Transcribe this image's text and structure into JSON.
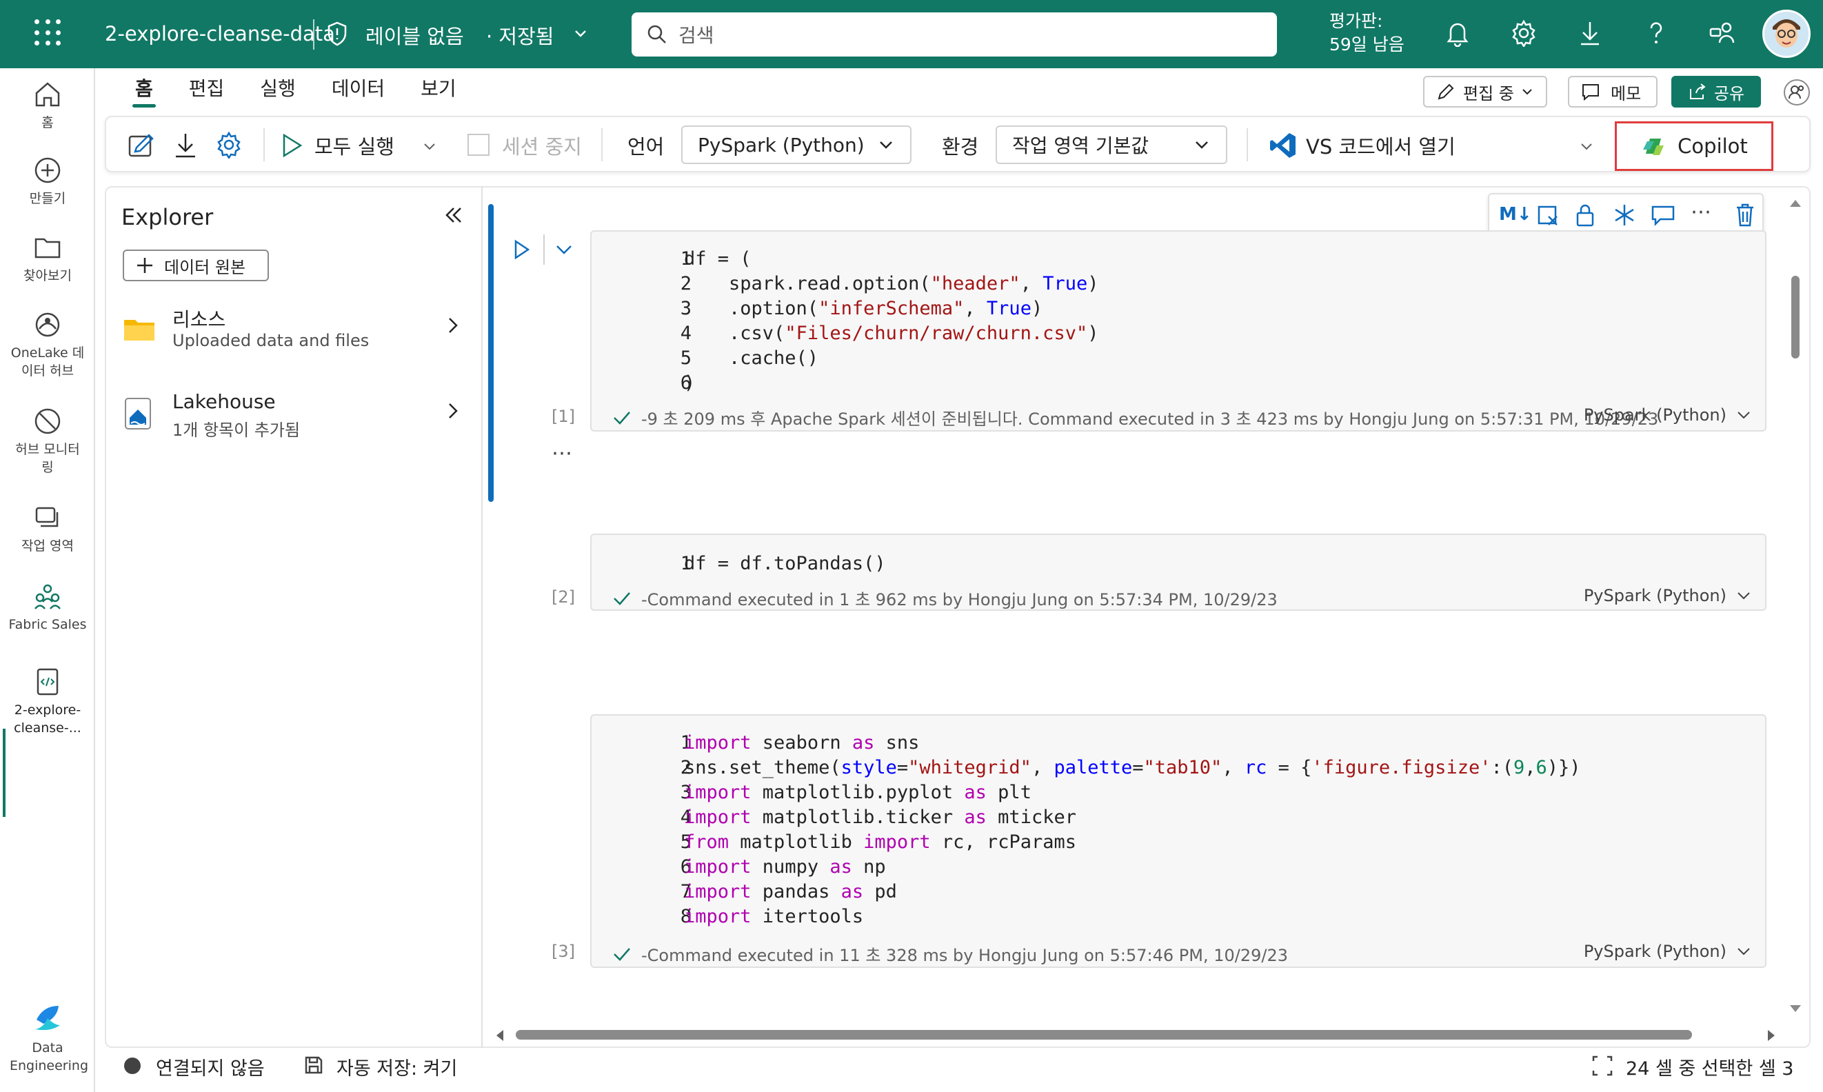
{
  "topbar": {
    "notebook_name": "2-explore-cleanse-data",
    "sensitivity_label": "레이블 없음",
    "save_status": "· 저장됨",
    "search_placeholder": "검색",
    "trial_line1": "평가판:",
    "trial_line2": "59일 남음"
  },
  "leftrail": {
    "items": [
      {
        "label": "홈",
        "icon": "home-icon"
      },
      {
        "label": "만들기",
        "icon": "create-icon"
      },
      {
        "label": "찾아보기",
        "icon": "folder-icon"
      },
      {
        "label": "OneLake 데이터 허브",
        "icon": "onelake-icon"
      },
      {
        "label": "허브 모니터링",
        "icon": "monitor-icon"
      },
      {
        "label": "작업 영역",
        "icon": "workspaces-icon"
      },
      {
        "label": "Fabric Sales",
        "icon": "fabric-sales-icon"
      },
      {
        "label": "2-explore-cleanse-...",
        "icon": "notebook-icon"
      }
    ],
    "bottom_label": "Data Engineering"
  },
  "ribbon": {
    "tabs": [
      "홈",
      "편집",
      "실행",
      "데이터",
      "보기"
    ],
    "active_tab": "홈",
    "editing_label": "편집 중",
    "memo_label": "메모",
    "share_label": "공유"
  },
  "toolbar": {
    "run_all": "모두 실행",
    "stop_session": "세션 중지",
    "language_label": "언어",
    "language_value": "PySpark (Python)",
    "env_label": "환경",
    "env_value": "작업 영역 기본값",
    "vscode_label": "VS 코드에서 열기",
    "copilot_label": "Copilot"
  },
  "explorer": {
    "title": "Explorer",
    "add_source": "데이터 원본",
    "items": [
      {
        "title": "리소스",
        "subtitle": "Uploaded data and files"
      },
      {
        "title": "Lakehouse",
        "subtitle": "1개 항목이 추가됨"
      }
    ]
  },
  "cells": [
    {
      "exec_count": "[1]",
      "status": "-9 초 209 ms 후 Apache Spark 세션이 준비됩니다. Command executed in 3 초 423 ms by Hongju Jung on 5:57:31 PM, 10/29/23",
      "lang": "PySpark (Python)"
    },
    {
      "exec_count": "[2]",
      "status": "-Command executed in 1 초 962 ms by Hongju Jung on 5:57:34 PM, 10/29/23",
      "lang": "PySpark (Python)"
    },
    {
      "exec_count": "[3]",
      "status": "-Command executed in 11 초 328 ms by Hongju Jung on 5:57:46 PM, 10/29/23",
      "lang": "PySpark (Python)"
    }
  ],
  "statusbar": {
    "connection": "연결되지 않음",
    "autosave": "자동 저장: 켜기",
    "cell_selection": "24 셀 중 선택한 셀 3"
  },
  "colors": {
    "brand": "#117865",
    "accent": "#0f6cbd",
    "highlight": "#e03c3c"
  }
}
